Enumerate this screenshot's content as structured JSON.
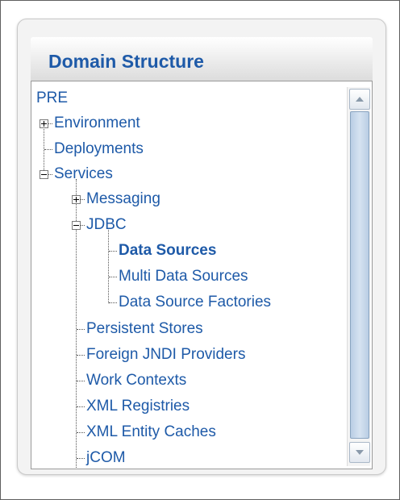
{
  "panel": {
    "title": "Domain Structure"
  },
  "tree": {
    "root": "PRE",
    "environment": "Environment",
    "deployments": "Deployments",
    "services": "Services",
    "messaging": "Messaging",
    "jdbc": "JDBC",
    "data_sources": "Data Sources",
    "multi_data_sources": "Multi Data Sources",
    "data_source_factories": "Data Source Factories",
    "persistent_stores": "Persistent Stores",
    "foreign_jndi_providers": "Foreign JNDI Providers",
    "work_contexts": "Work Contexts",
    "xml_registries": "XML Registries",
    "xml_entity_caches": "XML Entity Caches",
    "jcom": "jCOM"
  },
  "selected_node": "Data Sources",
  "colors": {
    "link": "#1e5aa8",
    "title": "#1e5aa8"
  },
  "icons": {
    "scroll_up": "triangle-up-icon",
    "scroll_down": "triangle-down-icon",
    "expand": "plus-box-icon",
    "collapse": "minus-box-icon"
  }
}
